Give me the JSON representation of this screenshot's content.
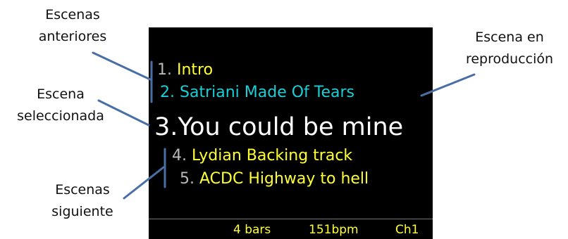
{
  "screen": {
    "scenes": [
      {
        "num": "1.",
        "name": "Intro",
        "state": "previous"
      },
      {
        "num": "2.",
        "name": "Satriani Made Of Tears",
        "state": "previous-playing"
      },
      {
        "num": "3.",
        "name": "You could be mine",
        "state": "selected"
      },
      {
        "num": "4.",
        "name": "Lydian Backing track",
        "state": "next"
      },
      {
        "num": "5.",
        "name": "ACDC Highway to hell",
        "state": "next"
      }
    ],
    "status": {
      "bars": "4 bars",
      "bpm": "151bpm",
      "channel": "Ch1"
    }
  },
  "annotations": {
    "previous_line1": "Escenas",
    "previous_line2": "anteriores",
    "selected_line1": "Escena",
    "selected_line2": "seleccionada",
    "next_line1": "Escenas",
    "next_line2": "siguiente",
    "playing_line1": "Escena en",
    "playing_line2": "reproducción"
  },
  "colors": {
    "screen_bg": "#000000",
    "scene_yellow": "#ffff33",
    "scene_cyan": "#19d0d8",
    "selected_white": "#ffffff",
    "number_gray": "#b9b9b9",
    "bracket_blue": "#4a6fa5"
  }
}
